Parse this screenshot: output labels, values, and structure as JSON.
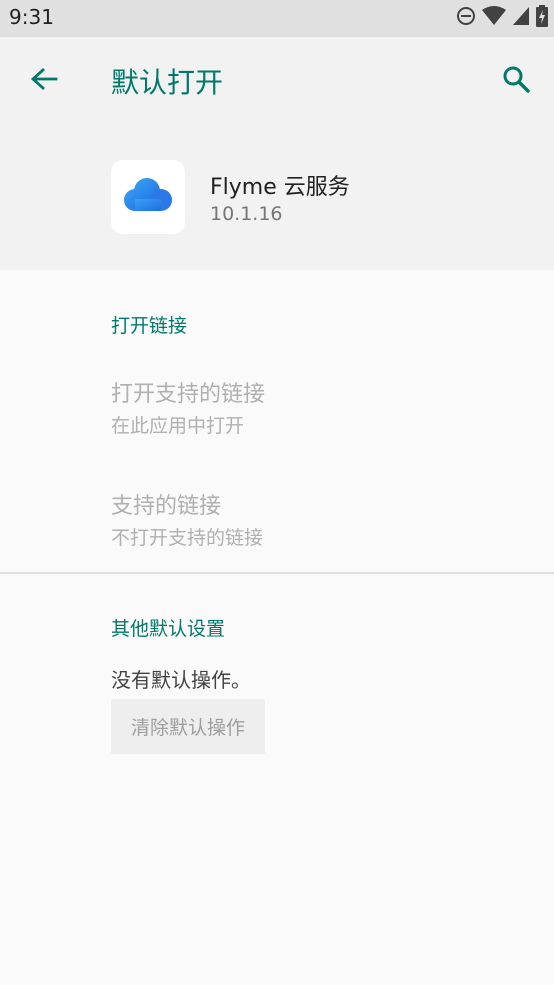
{
  "status_bar": {
    "time": "9:31",
    "icons": [
      "do-not-disturb-icon",
      "wifi-icon",
      "signal-icon",
      "battery-charging-icon"
    ]
  },
  "app_bar": {
    "title": "默认打开",
    "back_icon": "arrow-back-icon",
    "search_icon": "search-icon"
  },
  "app": {
    "name": "Flyme 云服务",
    "version": "10.1.16",
    "icon": "cloud-icon"
  },
  "open_links": {
    "section_title": "打开链接",
    "items": [
      {
        "title": "打开支持的链接",
        "summary": "在此应用中打开"
      },
      {
        "title": "支持的链接",
        "summary": "不打开支持的链接"
      }
    ]
  },
  "other_defaults": {
    "section_title": "其他默认设置",
    "message": "没有默认操作。",
    "clear_button": "清除默认操作"
  },
  "colors": {
    "accent": "#00796b",
    "disabled_text": "#b0b0b0",
    "header_bg": "#f2f2f2",
    "status_bar_bg": "#e0e0e0"
  }
}
